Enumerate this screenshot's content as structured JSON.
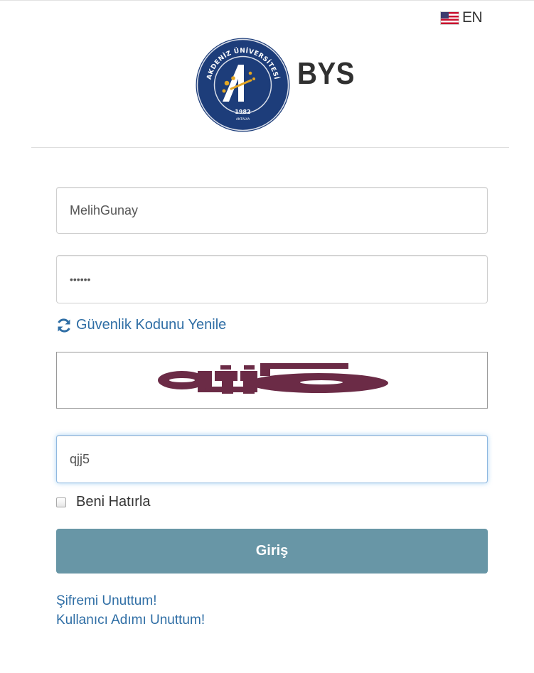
{
  "language": {
    "flag_icon": "us-flag-icon",
    "label": "EN"
  },
  "brand": {
    "logo": {
      "icon": "akdeniz-university-seal-icon",
      "ring_text": "AKDENİZ ÜNİVERSİTESİ",
      "year": "1982",
      "city": "ANTALYA",
      "colors": {
        "navy": "#1d3d7a",
        "gold": "#e3a623",
        "white": "#ffffff"
      }
    },
    "name": "BYS"
  },
  "login_form": {
    "username": {
      "value": "MelihGunay"
    },
    "password": {
      "value": "••••••"
    },
    "refresh_captcha": {
      "icon": "refresh-icon",
      "label": "Güvenlik Kodunu Yenile"
    },
    "captcha": {
      "text": "qjj5",
      "color": "#6b2b46"
    },
    "security_code": {
      "value": "qjj5"
    },
    "remember_me": {
      "label": "Beni Hatırla",
      "checked": false
    },
    "submit_label": "Giriş",
    "submit_color": "#6896a6"
  },
  "links": {
    "forgot_password": "Şifremi Unuttum!",
    "forgot_username": "Kullanıcı Adımı Unuttum!"
  }
}
